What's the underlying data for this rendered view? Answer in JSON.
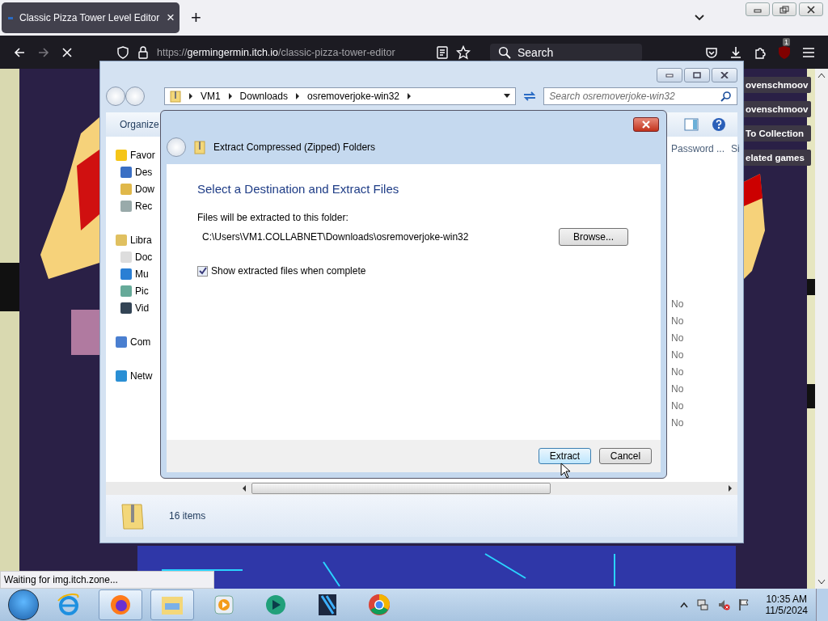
{
  "browser": {
    "tab": {
      "title": "Classic Pizza Tower Level Editor",
      "close": "×",
      "selected": true
    },
    "new_tab": "+",
    "url_host": "germingermin.itch.io",
    "url_prefix": "https://",
    "url_path": "/classic-pizza-tower-editor",
    "search_placeholder": "Search",
    "extension_badge": "1",
    "page_buttons": [
      "ovenschmoov",
      "ovenschmoov",
      "To Collection",
      "elated games"
    ],
    "status": "Waiting for img.itch.zone..."
  },
  "explorer": {
    "breadcrumbs": [
      "VM1",
      "Downloads",
      "osremoverjoke-win32"
    ],
    "search_placeholder": "Search osremoverjoke-win32",
    "toolbar_label": "Organize",
    "nav": [
      {
        "label": "Favor",
        "kind": "star",
        "children": [
          {
            "label": "Des",
            "kind": "desktop"
          },
          {
            "label": "Dow",
            "kind": "downloads"
          },
          {
            "label": "Rec",
            "kind": "recent"
          }
        ]
      },
      {
        "label": "Libra",
        "kind": "library",
        "children": [
          {
            "label": "Doc",
            "kind": "document"
          },
          {
            "label": "Mu",
            "kind": "music"
          },
          {
            "label": "Pic",
            "kind": "picture"
          },
          {
            "label": "Vid",
            "kind": "video"
          }
        ]
      },
      {
        "label": "Com",
        "kind": "computer"
      },
      {
        "label": "Netw",
        "kind": "network"
      }
    ],
    "columns": [
      "Password ...",
      "Si"
    ],
    "password_values": [
      "No",
      "No",
      "No",
      "No",
      "No",
      "No",
      "No",
      "No"
    ],
    "status": "16 items"
  },
  "dialog": {
    "title": "Extract Compressed (Zipped) Folders",
    "heading": "Select a Destination and Extract Files",
    "folder_label": "Files will be extracted to this folder:",
    "path": "C:\\Users\\VM1.COLLABNET\\Downloads\\osremoverjoke-win32",
    "browse": "Browse...",
    "show_files": {
      "label": "Show extracted files when complete",
      "checked": true
    },
    "buttons": [
      {
        "label": "Extract",
        "default": true
      },
      {
        "label": "Cancel",
        "default": false
      }
    ]
  },
  "taskbar": {
    "apps": [
      {
        "kind": "ie",
        "active": false
      },
      {
        "kind": "firefox",
        "active": true
      },
      {
        "kind": "explorer",
        "active": true
      },
      {
        "kind": "media",
        "active": false
      },
      {
        "kind": "green",
        "active": false
      },
      {
        "kind": "editor",
        "active": false
      },
      {
        "kind": "chrome",
        "active": false
      }
    ],
    "time": "10:35 AM",
    "date": "11/5/2024"
  }
}
